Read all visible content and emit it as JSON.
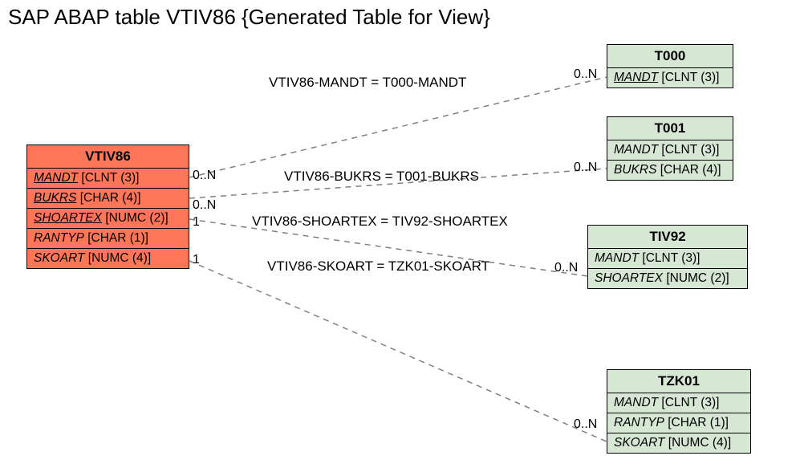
{
  "title": "SAP ABAP table VTIV86 {Generated Table for View}",
  "entities": {
    "vtiv86": {
      "name": "VTIV86",
      "fields": [
        {
          "name": "MANDT",
          "type": "[CLNT (3)]",
          "underline": true
        },
        {
          "name": "BUKRS",
          "type": "[CHAR (4)]",
          "underline": true
        },
        {
          "name": "SHOARTEX",
          "type": "[NUMC (2)]",
          "underline": true
        },
        {
          "name": "RANTYP",
          "type": "[CHAR (1)]",
          "underline": false
        },
        {
          "name": "SKOART",
          "type": "[NUMC (4)]",
          "underline": false
        }
      ]
    },
    "t000": {
      "name": "T000",
      "fields": [
        {
          "name": "MANDT",
          "type": "[CLNT (3)]",
          "underline": true
        }
      ]
    },
    "t001": {
      "name": "T001",
      "fields": [
        {
          "name": "MANDT",
          "type": "[CLNT (3)]",
          "underline": false
        },
        {
          "name": "BUKRS",
          "type": "[CHAR (4)]",
          "underline": false
        }
      ]
    },
    "tiv92": {
      "name": "TIV92",
      "fields": [
        {
          "name": "MANDT",
          "type": "[CLNT (3)]",
          "underline": false
        },
        {
          "name": "SHOARTEX",
          "type": "[NUMC (2)]",
          "underline": false
        }
      ]
    },
    "tzk01": {
      "name": "TZK01",
      "fields": [
        {
          "name": "MANDT",
          "type": "[CLNT (3)]",
          "underline": false
        },
        {
          "name": "RANTYP",
          "type": "[CHAR (1)]",
          "underline": false
        },
        {
          "name": "SKOART",
          "type": "[NUMC (4)]",
          "underline": false
        }
      ]
    }
  },
  "relationships": {
    "r1": {
      "label": "VTIV86-MANDT = T000-MANDT",
      "leftCard": "0..N",
      "rightCard": "0..N"
    },
    "r2": {
      "label": "VTIV86-BUKRS = T001-BUKRS",
      "leftCard": "0..N",
      "rightCard": "0..N"
    },
    "r3": {
      "label": "VTIV86-SHOARTEX = TIV92-SHOARTEX",
      "leftCard": "1",
      "rightCard": "0..N"
    },
    "r4": {
      "label": "VTIV86-SKOART = TZK01-SKOART",
      "leftCard": "1",
      "rightCard": "0..N"
    }
  }
}
